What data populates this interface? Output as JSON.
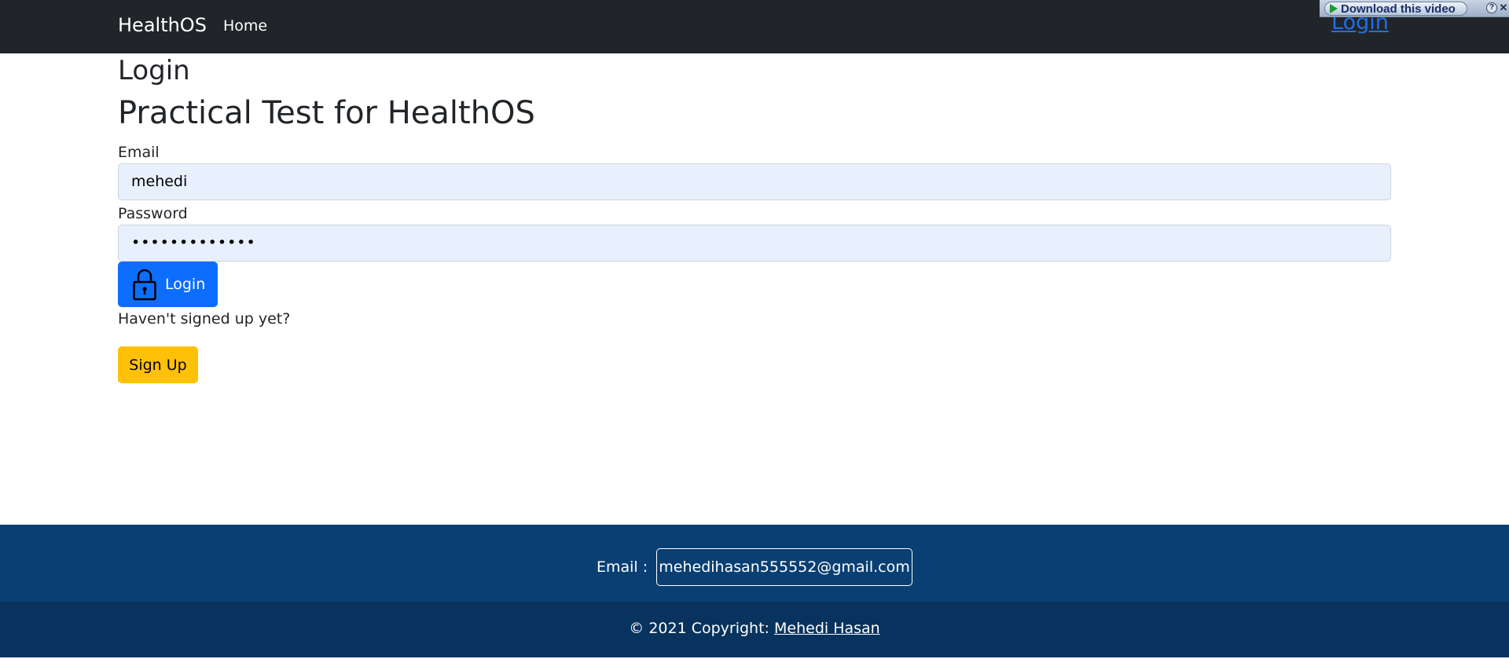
{
  "navbar": {
    "brand": "HealthOS",
    "home_label": "Home",
    "login_link": "Login",
    "background": "#212529"
  },
  "download_bar": {
    "label": "Download this video",
    "help": "?",
    "close": "✕"
  },
  "main": {
    "title": "Login",
    "subtitle": "Practical Test for HealthOS",
    "email_label": "Email",
    "email_value": "mehedi",
    "password_label": "Password",
    "password_value": "•••••••••••••",
    "login_button": "Login",
    "signup_prompt": "Haven't signed up yet?",
    "signup_button": "Sign Up"
  },
  "footer": {
    "email_label": "Email :",
    "email_value": "mehedihasan555552@gmail.com",
    "copyright_prefix": "© 2021 Copyright: ",
    "author": "Mehedi Hasan"
  },
  "colors": {
    "primary": "#0d6efd",
    "warning": "#ffc107",
    "footer_top": "#0a3f73",
    "footer_bottom": "#08335e",
    "input_bg": "#e8f0fe"
  },
  "icons": {
    "login_button": "lock-icon",
    "download_bar": "play-icon"
  }
}
